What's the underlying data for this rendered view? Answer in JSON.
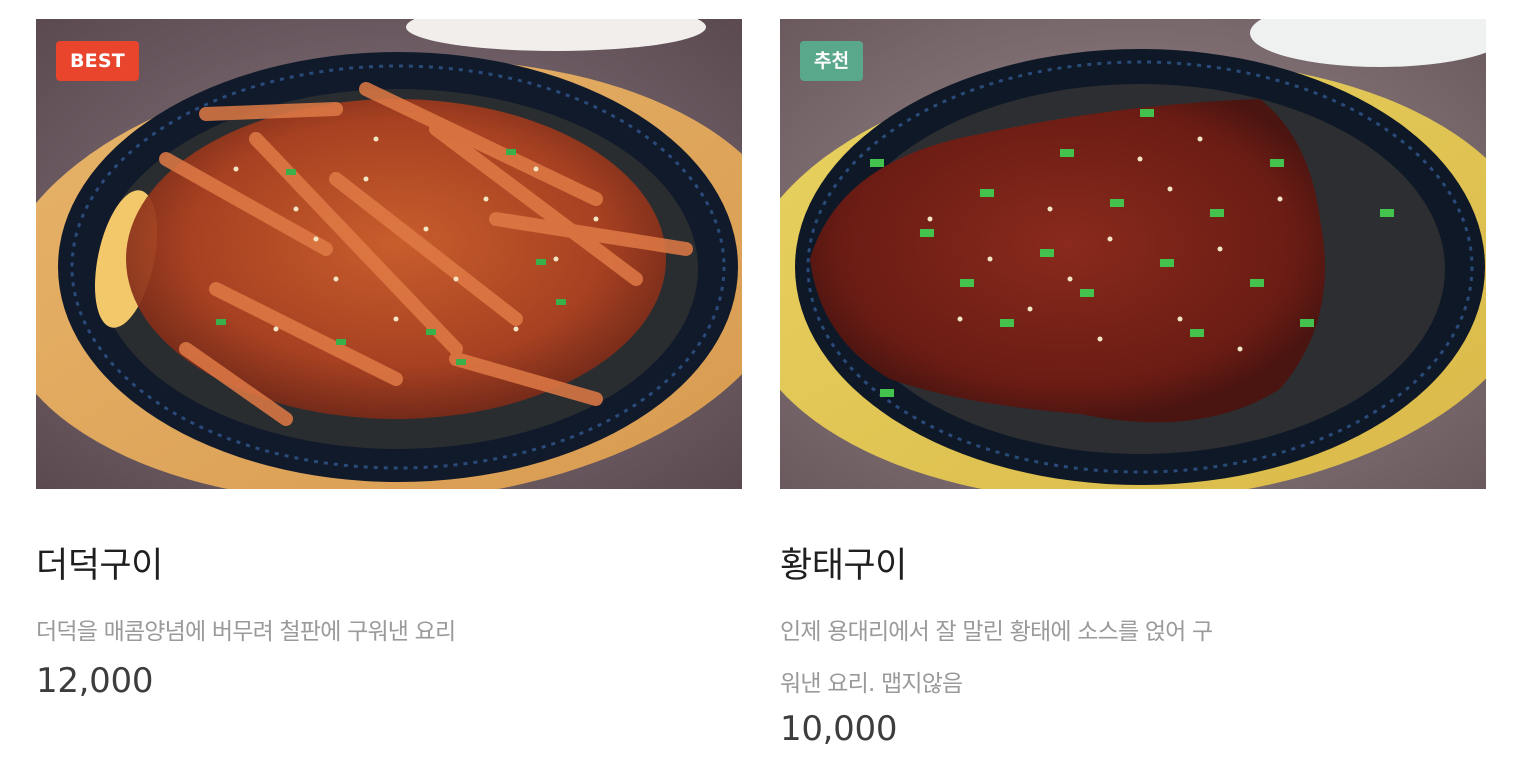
{
  "accent_colors": {
    "best_badge": "#e8452c",
    "recommend_badge": "#5aa88c"
  },
  "menu_items": [
    {
      "badge": "BEST",
      "badge_color": "#e8452c",
      "name": "더덕구이",
      "description_lines": [
        "더덕을 매콤양념에 버무려 철판에 구워낸 요리"
      ],
      "price": "12,000",
      "image": "grilled-deodeok-on-sizzling-plate"
    },
    {
      "badge": "추천",
      "badge_color": "#5aa88c",
      "name": "황태구이",
      "description_lines": [
        "인제 용대리에서 잘 말린 황태에 소스를 얹어 구",
        "워낸 요리. 맵지않음"
      ],
      "price": "10,000",
      "image": "grilled-hwangtae-on-sizzling-plate"
    }
  ]
}
